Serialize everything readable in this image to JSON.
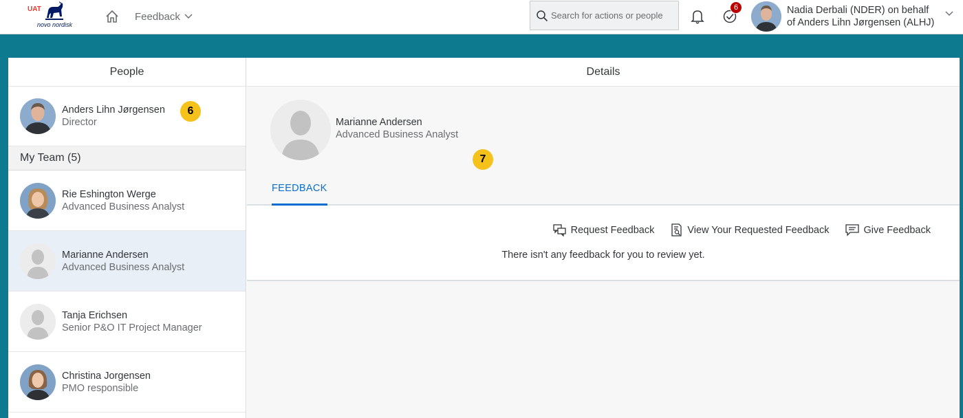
{
  "shell": {
    "logo": {
      "env_label": "UAT",
      "brand_text": "novo nordisk"
    },
    "app_menu_label": "Feedback",
    "search": {
      "placeholder": "Search for actions or people",
      "value": ""
    },
    "notifications_badge": "6",
    "user": {
      "name_line1": "Nadia Derbali (NDER) on behalf",
      "name_line2": "of Anders Lihn Jørgensen (ALHJ)"
    },
    "icons": [
      "home-icon",
      "chevron-down-icon",
      "search-icon",
      "bell-icon",
      "tasks-check-icon"
    ]
  },
  "people_panel": {
    "header": "People",
    "me": {
      "name": "Anders Lihn Jørgensen",
      "title": "Director",
      "callout": "6"
    },
    "team_header": "My Team (5)",
    "team": [
      {
        "name": "Rie Eshington Werge",
        "title": "Advanced Business Analyst",
        "selected": false
      },
      {
        "name": "Marianne Andersen",
        "title": "Advanced Business Analyst",
        "selected": true
      },
      {
        "name": "Tanja Erichsen",
        "title": "Senior P&O IT Project Manager",
        "selected": false
      },
      {
        "name": "Christina Jorgensen",
        "title": "PMO responsible",
        "selected": false
      }
    ]
  },
  "details_panel": {
    "header": "Details",
    "profile": {
      "name": "Marianne Andersen",
      "title": "Advanced Business Analyst",
      "callout": "7"
    },
    "tabs": [
      {
        "label": "FEEDBACK",
        "active": true
      }
    ],
    "actions": {
      "request": "Request Feedback",
      "view_requested": "View Your Requested Feedback",
      "give": "Give Feedback"
    },
    "empty_message": "There isn't any feedback for you to review yet."
  },
  "colors": {
    "brand_teal": "#0e7a8f",
    "selected_row": "#e8eff6",
    "callout": "#f5c11b",
    "badge": "#bb0000",
    "link_blue": "#0a6ed1"
  }
}
